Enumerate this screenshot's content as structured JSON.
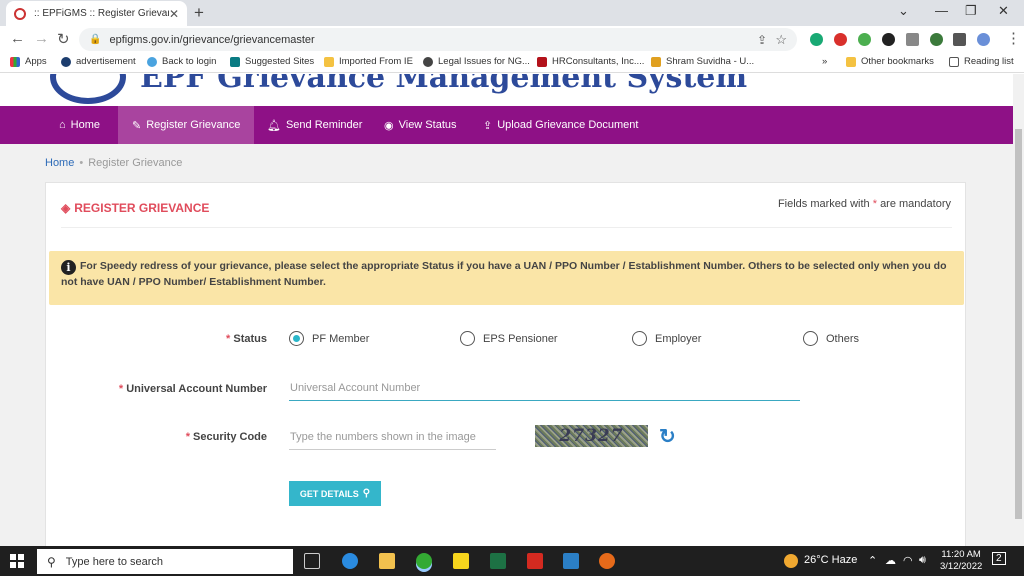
{
  "browser": {
    "tab_title": ":: EPFiGMS :: Register Grievance",
    "url": "epfigms.gov.in/grievance/grievancemaster",
    "bookmarks": [
      {
        "label": "Apps",
        "icon": "apps-grid-icon"
      },
      {
        "label": "advertisement",
        "icon": "circle-q-icon"
      },
      {
        "label": "Back to login",
        "icon": "cloud-icon"
      },
      {
        "label": "Suggested Sites",
        "icon": "bing-icon"
      },
      {
        "label": "Imported From IE",
        "icon": "folder-icon"
      },
      {
        "label": "Legal Issues for NG...",
        "icon": "globe-icon"
      },
      {
        "label": "HRConsultants, Inc....",
        "icon": "hr-icon"
      },
      {
        "label": "Shram Suvidha - U...",
        "icon": "figure-icon"
      }
    ],
    "other_bookmarks": "Other bookmarks",
    "reading_list": "Reading list",
    "more": "»"
  },
  "site": {
    "title": "EPF Grievance Management System"
  },
  "menu": [
    {
      "label": "Home",
      "icon": "home-icon",
      "active": false
    },
    {
      "label": "Register Grievance",
      "icon": "edit-icon",
      "active": true
    },
    {
      "label": "Send Reminder",
      "icon": "bell-icon",
      "active": false
    },
    {
      "label": "View Status",
      "icon": "eye-icon",
      "active": false
    },
    {
      "label": "Upload Grievance Document",
      "icon": "upload-icon",
      "active": false
    }
  ],
  "breadcrumb": {
    "home": "Home",
    "current": "Register Grievance"
  },
  "card": {
    "title": "REGISTER GRIEVANCE",
    "mandatory_prefix": "Fields marked with",
    "mandatory_star": "*",
    "mandatory_suffix": "are mandatory",
    "notice": "For Speedy redress of your grievance, please select the appropriate Status if you have a UAN / PPO Number / Establishment Number. Others to be selected only when you do not have UAN / PPO Number/ Establishment Number."
  },
  "form": {
    "status_label": "Status",
    "status_options": [
      {
        "label": "PF Member",
        "selected": true
      },
      {
        "label": "EPS Pensioner",
        "selected": false
      },
      {
        "label": "Employer",
        "selected": false
      },
      {
        "label": "Others",
        "selected": false
      }
    ],
    "uan_label": "Universal Account Number",
    "uan_placeholder": "Universal Account Number",
    "uan_value": "",
    "security_label": "Security Code",
    "security_placeholder": "Type the numbers shown in the image",
    "captcha_text": "27327",
    "get_details": "GET DETAILS",
    "required_mark": "*"
  },
  "taskbar": {
    "search_placeholder": "Type here to search",
    "weather": "26°C  Haze",
    "time": "11:20 AM",
    "date": "3/12/2022",
    "notification_count": "2"
  },
  "colors": {
    "menu_bg": "#8e1186",
    "menu_active": "#a9449f",
    "accent_red": "#e04c5c",
    "notice_bg": "#fae5a7",
    "button_teal": "#34b6cb"
  }
}
